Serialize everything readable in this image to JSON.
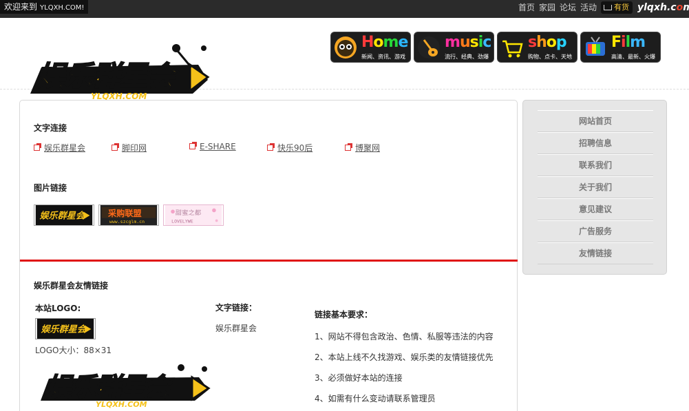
{
  "topbar": {
    "welcome": "欢迎来到",
    "welcome_url": "YLQXH.COM!",
    "nav": [
      "首页",
      "家园",
      "论坛",
      "活动"
    ],
    "cart_label": "有货",
    "brand_small_a": "ylqxh.c",
    "brand_small_b": "m"
  },
  "header": {
    "logo_text": "娱乐群星会",
    "logo_sub": "YLQXH.COM",
    "banners": [
      {
        "title": "Home",
        "sub": "新闻、资讯、游戏",
        "icon": "owl-icon",
        "colors": [
          "#ff3b3b",
          "#ffe600",
          "#26d83a",
          "#2bb7ff"
        ]
      },
      {
        "title": "music",
        "sub": "流行、经典、劲爆",
        "icon": "guitar-icon",
        "colors": [
          "#ff2fa0",
          "#ff7a1a",
          "#ffe600",
          "#2bd63f",
          "#3bb8ff"
        ]
      },
      {
        "title": "shop",
        "sub": "购物、点卡、天地",
        "icon": "cart-icon",
        "colors": [
          "#ff3b3b",
          "#ff9b1a",
          "#ffe600",
          "#27d2ff"
        ]
      },
      {
        "title": "Film",
        "sub": "高清、最新、火爆",
        "icon": "tv-icon",
        "colors": [
          "#ffe600",
          "#ff3b3b",
          "#2bd63f",
          "#3bb8ff"
        ]
      }
    ]
  },
  "main": {
    "text_links_title": "文字连接",
    "text_links": [
      "娱乐群星会",
      "脚印网",
      "E-SHARE",
      "快乐90后",
      "博聚网"
    ],
    "image_links_title": "图片链接",
    "image_links": [
      {
        "text": "娱乐群星会",
        "sub": ""
      },
      {
        "text": "采购联盟",
        "sub": "www.szcglm.cn"
      },
      {
        "text": "甜蜜之都",
        "sub": "LOVELYWE"
      }
    ],
    "friend_title": "娱乐群星会友情链接",
    "site_logo_label": "本站LOGO:",
    "logo_size": "LOGO大小：88×31",
    "text_link_label": "文字链接：",
    "text_link_value": "娱乐群星会",
    "req_title": "链接基本要求：",
    "requirements": [
      "1、网站不得包含政治、色情、私服等违法的内容",
      "2、本站上线不久找游戏、娱乐类的友情链接优先",
      "3、必须做好本站的连接",
      "4、如需有什么变动请联系管理员"
    ]
  },
  "sidebar": {
    "items": [
      "网站首页",
      "招聘信息",
      "联系我们",
      "关于我们",
      "意见建议",
      "广告服务",
      "友情链接"
    ]
  },
  "colors": {
    "accent_red": "#e01010",
    "logo_yellow": "#f5c11a",
    "topbar": "#2b2b2b"
  }
}
